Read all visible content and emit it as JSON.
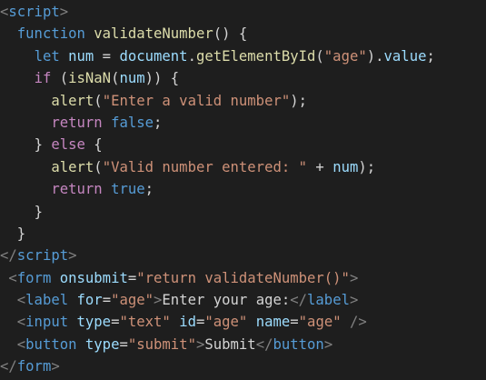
{
  "editor": {
    "language": "html",
    "theme": "dark",
    "background": "#1e1e1e",
    "colors": {
      "tag": "#569cd6",
      "punctuation": "#808080",
      "keyword": "#569cd6",
      "control": "#c586c0",
      "function": "#dcdcaa",
      "variable": "#9cdcfe",
      "string": "#ce9178",
      "text": "#d4d4d4"
    },
    "lines": [
      {
        "indent": "",
        "tokens": [
          {
            "t": "<",
            "k": "punct"
          },
          {
            "t": "script",
            "k": "tag"
          },
          {
            "t": ">",
            "k": "punct"
          }
        ]
      },
      {
        "indent": "  ",
        "tokens": [
          {
            "t": "function",
            "k": "kw"
          },
          {
            "t": " ",
            "k": "plain"
          },
          {
            "t": "validateNumber",
            "k": "fn"
          },
          {
            "t": "() {",
            "k": "plain"
          }
        ]
      },
      {
        "indent": "    ",
        "tokens": [
          {
            "t": "let",
            "k": "kw"
          },
          {
            "t": " ",
            "k": "plain"
          },
          {
            "t": "num",
            "k": "var"
          },
          {
            "t": " = ",
            "k": "plain"
          },
          {
            "t": "document",
            "k": "var"
          },
          {
            "t": ".",
            "k": "plain"
          },
          {
            "t": "getElementById",
            "k": "fn"
          },
          {
            "t": "(",
            "k": "plain"
          },
          {
            "t": "\"age\"",
            "k": "str"
          },
          {
            "t": ").",
            "k": "plain"
          },
          {
            "t": "value",
            "k": "var"
          },
          {
            "t": ";",
            "k": "plain"
          }
        ]
      },
      {
        "indent": "    ",
        "tokens": [
          {
            "t": "if",
            "k": "ctl"
          },
          {
            "t": " (",
            "k": "plain"
          },
          {
            "t": "isNaN",
            "k": "fn"
          },
          {
            "t": "(",
            "k": "plain"
          },
          {
            "t": "num",
            "k": "var"
          },
          {
            "t": ")) {",
            "k": "plain"
          }
        ]
      },
      {
        "indent": "      ",
        "tokens": [
          {
            "t": "alert",
            "k": "fn"
          },
          {
            "t": "(",
            "k": "plain"
          },
          {
            "t": "\"Enter a valid number\"",
            "k": "str"
          },
          {
            "t": ");",
            "k": "plain"
          }
        ]
      },
      {
        "indent": "      ",
        "tokens": [
          {
            "t": "return",
            "k": "ctl"
          },
          {
            "t": " ",
            "k": "plain"
          },
          {
            "t": "false",
            "k": "kw"
          },
          {
            "t": ";",
            "k": "plain"
          }
        ]
      },
      {
        "indent": "    ",
        "tokens": [
          {
            "t": "} ",
            "k": "plain"
          },
          {
            "t": "else",
            "k": "ctl"
          },
          {
            "t": " {",
            "k": "plain"
          }
        ]
      },
      {
        "indent": "      ",
        "tokens": [
          {
            "t": "alert",
            "k": "fn"
          },
          {
            "t": "(",
            "k": "plain"
          },
          {
            "t": "\"Valid number entered: \"",
            "k": "str"
          },
          {
            "t": " + ",
            "k": "plain"
          },
          {
            "t": "num",
            "k": "var"
          },
          {
            "t": ");",
            "k": "plain"
          }
        ]
      },
      {
        "indent": "      ",
        "tokens": [
          {
            "t": "return",
            "k": "ctl"
          },
          {
            "t": " ",
            "k": "plain"
          },
          {
            "t": "true",
            "k": "kw"
          },
          {
            "t": ";",
            "k": "plain"
          }
        ]
      },
      {
        "indent": "    ",
        "tokens": [
          {
            "t": "}",
            "k": "plain"
          }
        ]
      },
      {
        "indent": "  ",
        "tokens": [
          {
            "t": "}",
            "k": "plain"
          }
        ]
      },
      {
        "indent": "",
        "tokens": [
          {
            "t": "</",
            "k": "punct"
          },
          {
            "t": "script",
            "k": "tag"
          },
          {
            "t": ">",
            "k": "punct"
          }
        ]
      },
      {
        "indent": " ",
        "tokens": [
          {
            "t": "<",
            "k": "punct"
          },
          {
            "t": "form",
            "k": "tag"
          },
          {
            "t": " ",
            "k": "plain"
          },
          {
            "t": "onsubmit",
            "k": "attr"
          },
          {
            "t": "=",
            "k": "plain"
          },
          {
            "t": "\"return validateNumber()\"",
            "k": "str"
          },
          {
            "t": ">",
            "k": "punct"
          }
        ]
      },
      {
        "indent": "  ",
        "tokens": [
          {
            "t": "<",
            "k": "punct"
          },
          {
            "t": "label",
            "k": "tag"
          },
          {
            "t": " ",
            "k": "plain"
          },
          {
            "t": "for",
            "k": "attr"
          },
          {
            "t": "=",
            "k": "plain"
          },
          {
            "t": "\"age\"",
            "k": "str"
          },
          {
            "t": ">",
            "k": "punct"
          },
          {
            "t": "Enter your age:",
            "k": "plain"
          },
          {
            "t": "</",
            "k": "punct"
          },
          {
            "t": "label",
            "k": "tag"
          },
          {
            "t": ">",
            "k": "punct"
          }
        ]
      },
      {
        "indent": "  ",
        "tokens": [
          {
            "t": "<",
            "k": "punct"
          },
          {
            "t": "input",
            "k": "tag"
          },
          {
            "t": " ",
            "k": "plain"
          },
          {
            "t": "type",
            "k": "attr"
          },
          {
            "t": "=",
            "k": "plain"
          },
          {
            "t": "\"text\"",
            "k": "str"
          },
          {
            "t": " ",
            "k": "plain"
          },
          {
            "t": "id",
            "k": "attr"
          },
          {
            "t": "=",
            "k": "plain"
          },
          {
            "t": "\"age\"",
            "k": "str"
          },
          {
            "t": " ",
            "k": "plain"
          },
          {
            "t": "name",
            "k": "attr"
          },
          {
            "t": "=",
            "k": "plain"
          },
          {
            "t": "\"age\"",
            "k": "str"
          },
          {
            "t": " ",
            "k": "plain"
          },
          {
            "t": "/>",
            "k": "punct"
          }
        ]
      },
      {
        "indent": "  ",
        "tokens": [
          {
            "t": "<",
            "k": "punct"
          },
          {
            "t": "button",
            "k": "tag"
          },
          {
            "t": " ",
            "k": "plain"
          },
          {
            "t": "type",
            "k": "attr"
          },
          {
            "t": "=",
            "k": "plain"
          },
          {
            "t": "\"submit\"",
            "k": "str"
          },
          {
            "t": ">",
            "k": "punct"
          },
          {
            "t": "Submit",
            "k": "plain"
          },
          {
            "t": "</",
            "k": "punct"
          },
          {
            "t": "button",
            "k": "tag"
          },
          {
            "t": ">",
            "k": "punct"
          }
        ]
      },
      {
        "indent": "",
        "tokens": [
          {
            "t": "</",
            "k": "punct"
          },
          {
            "t": "form",
            "k": "tag"
          },
          {
            "t": ">",
            "k": "punct"
          }
        ]
      }
    ]
  }
}
